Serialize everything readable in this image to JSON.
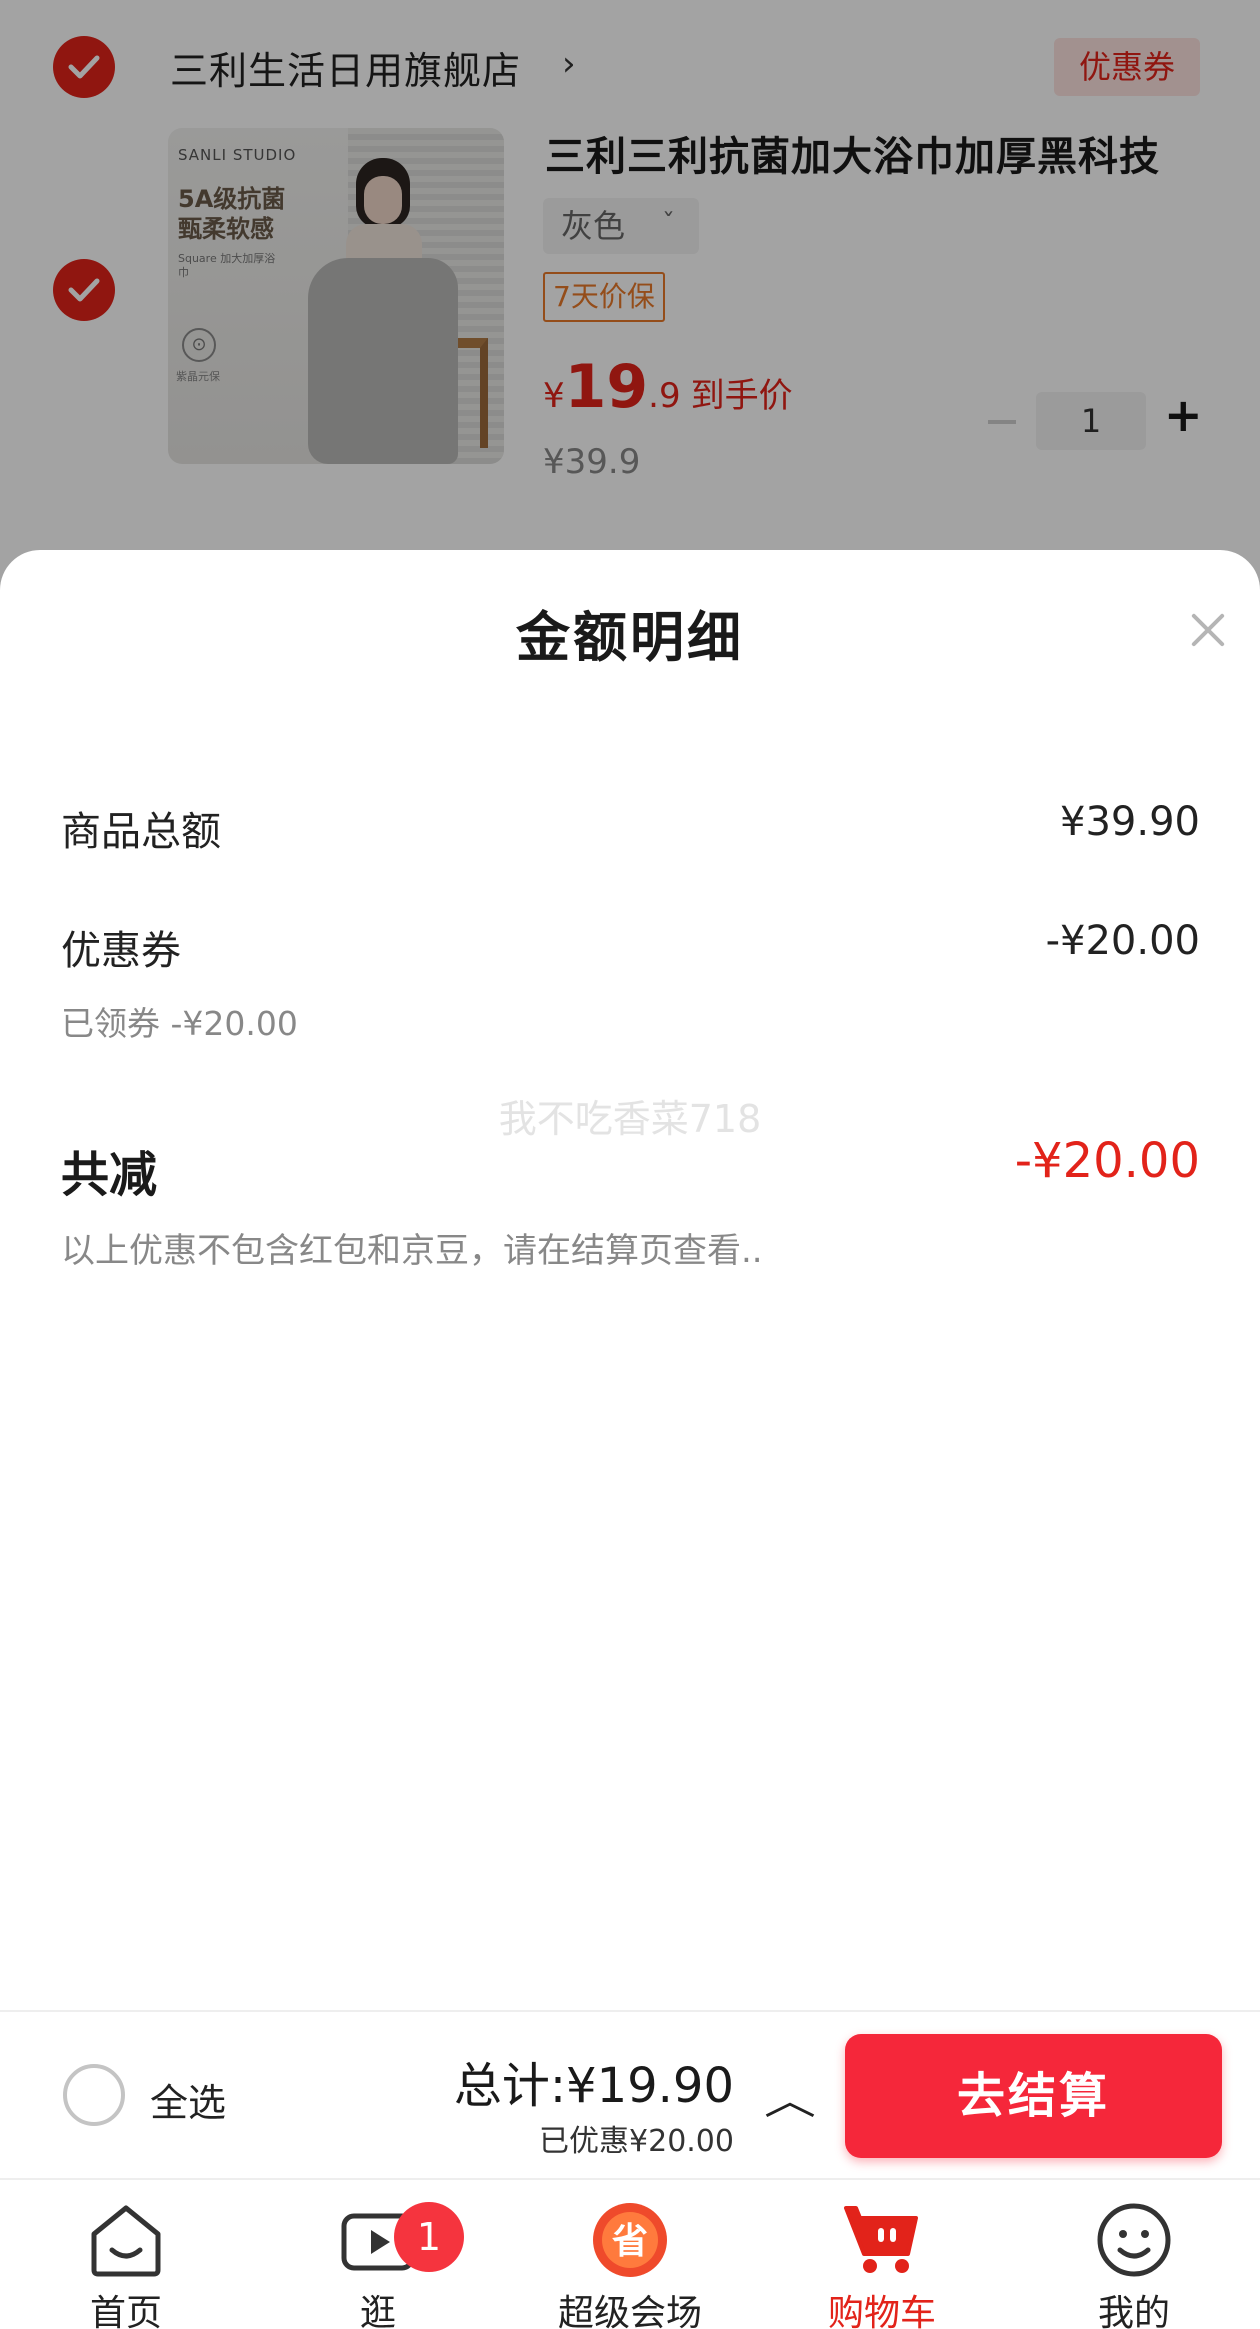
{
  "store": {
    "name": "三利生活日用旗舰店",
    "arrow": "›",
    "coupon_tag": "优惠券"
  },
  "product": {
    "title": "三利三利抗菌加大浴巾加厚黑科技",
    "spec": "灰色",
    "price_protect": "7天价保",
    "price_symbol": "¥",
    "price_int": "19",
    "price_dec": ".9",
    "price_label": "到手价",
    "original_price": "¥39.9",
    "quantity": "1",
    "image": {
      "brand": "SANLI STUDIO",
      "slogan": "5A级抗菌甄柔软感",
      "sub": "Square 加大加厚浴巾",
      "mark": "紫晶元保"
    }
  },
  "sheet": {
    "title": "金额明细",
    "rows": [
      {
        "label": "商品总额",
        "value": "¥39.90"
      },
      {
        "label": "优惠券",
        "value": "-¥20.00",
        "sub": "已领券 -¥20.00"
      }
    ],
    "watermark": "我不吃香菜718",
    "total": {
      "label": "共减",
      "value": "-¥20.00"
    },
    "note": "以上优惠不包含红包和京豆，请在结算页查看.."
  },
  "checkout": {
    "select_all": "全选",
    "total_label": "总计:¥19.90",
    "discount_label": "已优惠¥20.00",
    "chevron": "︿",
    "button": "去结算"
  },
  "tabbar": {
    "items": [
      {
        "label": "首页",
        "icon": "home-icon"
      },
      {
        "label": "逛",
        "icon": "video-icon",
        "badge": "1"
      },
      {
        "label": "超级会场",
        "icon": "super-venue-icon"
      },
      {
        "label": "购物车",
        "icon": "cart-icon",
        "active": true
      },
      {
        "label": "我的",
        "icon": "profile-icon"
      }
    ]
  },
  "colors": {
    "accent": "#e2231a",
    "checkout_button": "#f5273a",
    "price_protect": "#e8792a"
  }
}
